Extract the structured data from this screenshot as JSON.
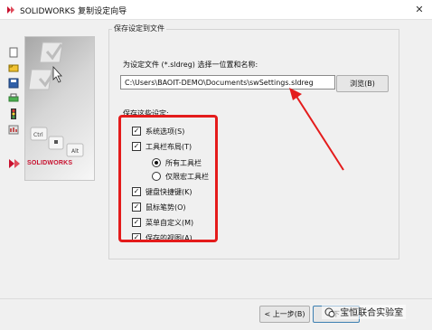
{
  "window": {
    "title": "SOLIDWORKS 复制设定向导",
    "close_glyph": "✕"
  },
  "left_panel": {
    "icons": [
      "document-icon",
      "open-folder-icon",
      "save-icon",
      "print-icon",
      "traffic-light-icon",
      "options-icon"
    ],
    "logo_text": "SOLIDWORKS",
    "keyboard_keys": [
      "Ctrl",
      "Alt"
    ]
  },
  "group": {
    "title": "保存设定到文件",
    "path_label": "为设定文件 (*.sldreg) 选择一位置和名称:",
    "path_value": "C:\\Users\\BAOIT-DEMO\\Documents\\swSettings.sldreg",
    "browse_label": "浏览(B)",
    "settings_label": "保存这些设定:",
    "options": [
      {
        "label": "系统选项(S)",
        "checked": true
      },
      {
        "label": "工具栏布局(T)",
        "checked": true
      },
      {
        "label": "所有工具栏",
        "selected": true
      },
      {
        "label": "仅限宏工具栏",
        "selected": false
      },
      {
        "label": "键盘快捷键(K)",
        "checked": true
      },
      {
        "label": "鼠标笔势(O)",
        "checked": true
      },
      {
        "label": "菜单自定义(M)",
        "checked": true
      },
      {
        "label": "保存的视图(A)",
        "checked": true
      }
    ]
  },
  "footer": {
    "back_label": "< 上一步(B)",
    "next_label": "下",
    "watermark": "宝恒联合实验室"
  },
  "colors": {
    "highlight": "#e41b1b",
    "arrow": "#e41b1b",
    "brand": "#c8102e"
  }
}
